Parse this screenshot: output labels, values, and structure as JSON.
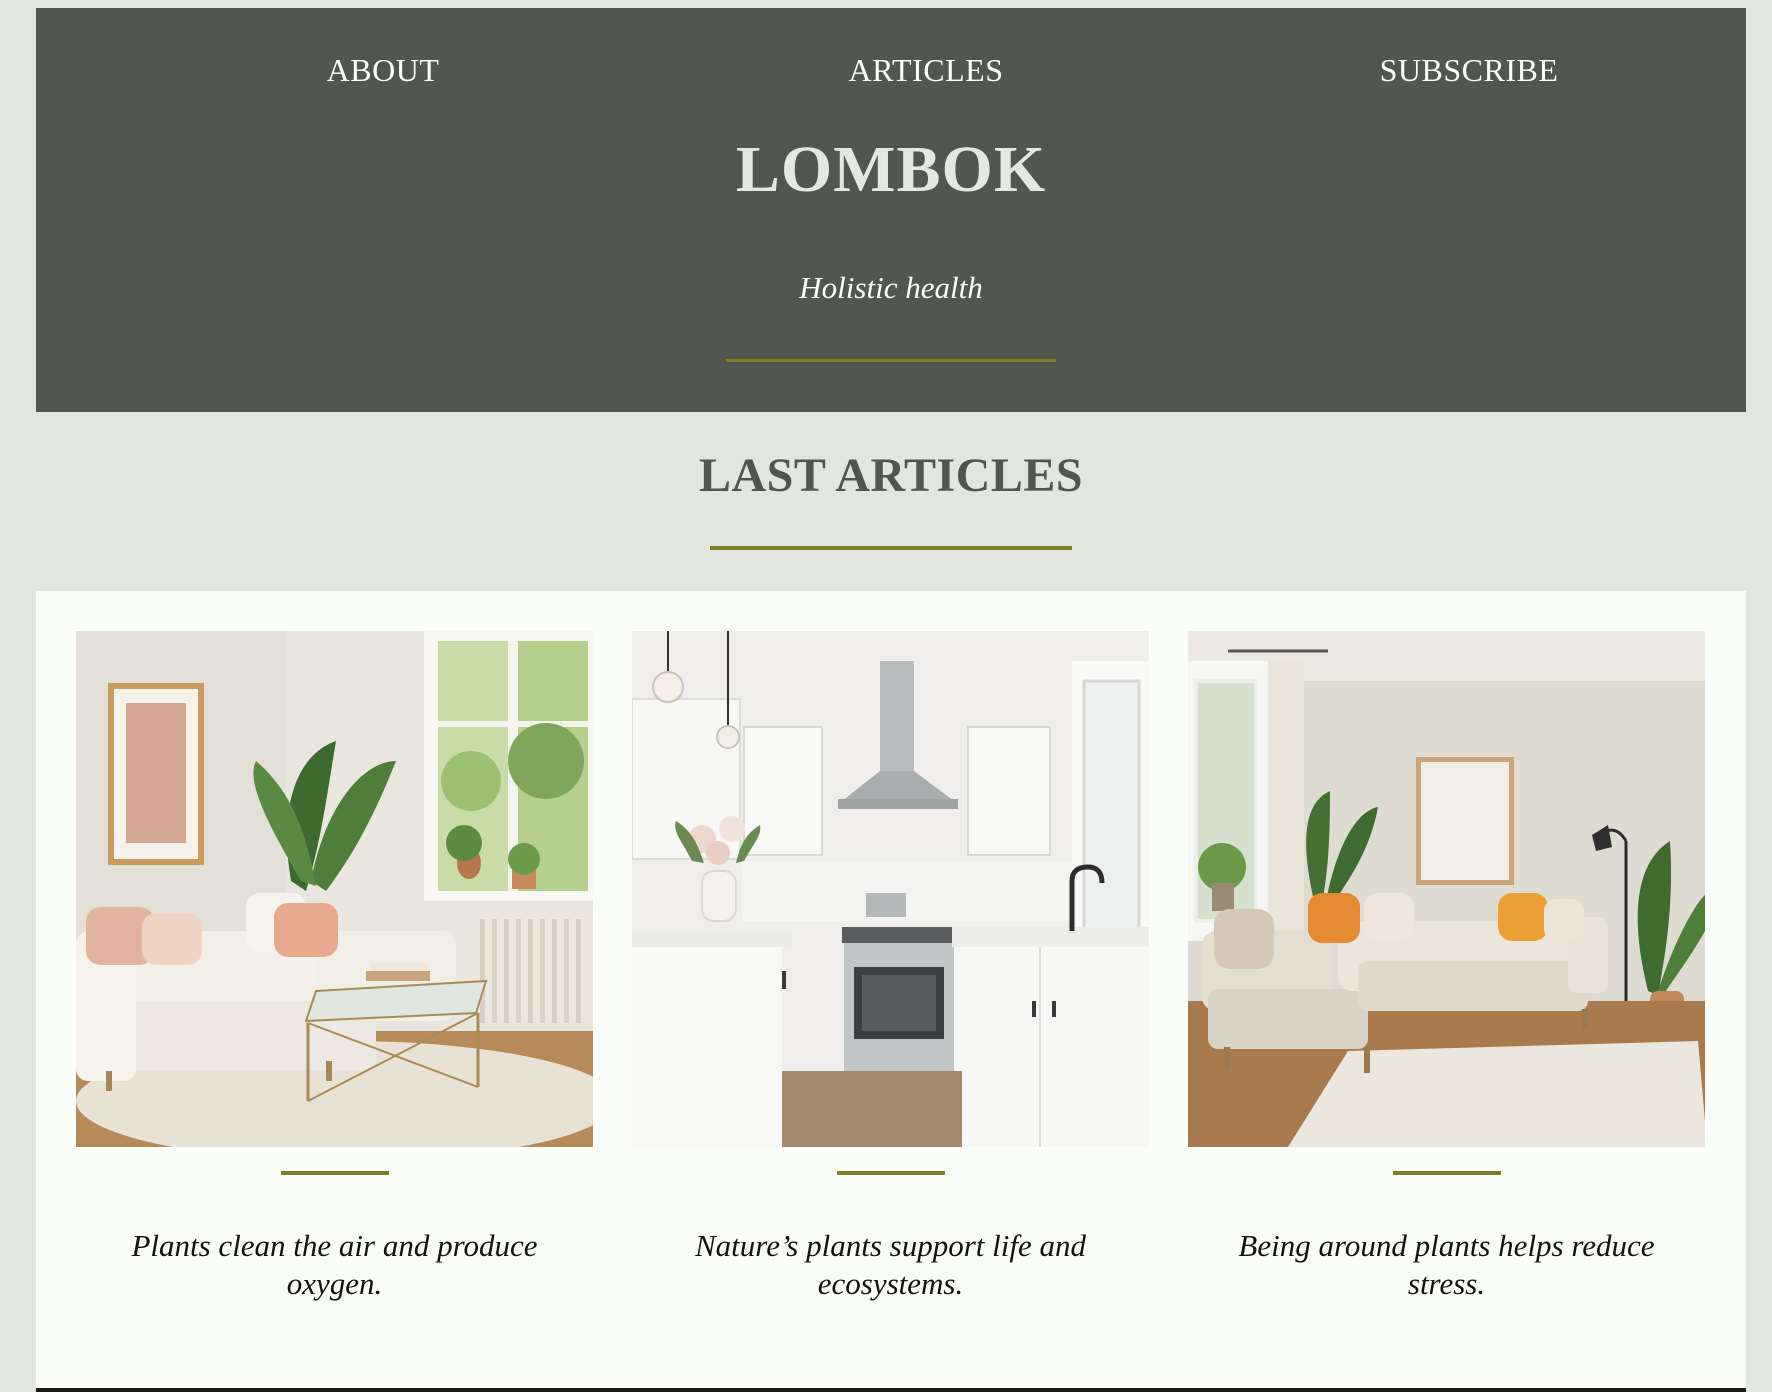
{
  "nav": {
    "about": "ABOUT",
    "articles": "ARTICLES",
    "subscribe": "SUBSCRIBE"
  },
  "header": {
    "title": "LOMBOK",
    "tagline": "Holistic health"
  },
  "section": {
    "title": "LAST ARTICLES"
  },
  "articles": [
    {
      "caption": "Plants clean the air and produce oxygen.",
      "image": "living-room-with-white-sofa-and-plant"
    },
    {
      "caption": "Nature’s plants support life and ecosystems.",
      "image": "white-kitchen-with-stove-and-flowers"
    },
    {
      "caption": "Being around plants helps reduce stress.",
      "image": "living-room-with-beige-sectional-and-orange-pillows"
    }
  ],
  "colors": {
    "background": "#e2e6df",
    "header": "#525650",
    "accent": "#7f7f26",
    "panel": "#fbfdf8",
    "title_text": "#e4e8df",
    "heading_text": "#505550"
  }
}
